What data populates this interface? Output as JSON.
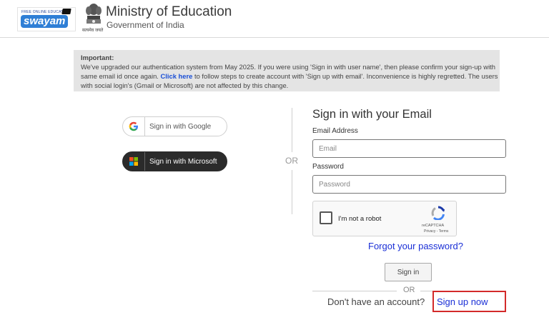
{
  "header": {
    "logo_small_text": "FREE ONLINE EDUCATION",
    "logo_word": "swayam",
    "emblem_motto": "सत्यमेव जयते",
    "ministry": "Ministry of Education",
    "government": "Government of India"
  },
  "notice": {
    "heading": "Important:",
    "text_before": "We've upgraded our authentication system from May 2025. If you were using 'Sign in with user name', then please confirm your sign-up with same email id once again. ",
    "link": "Click here",
    "text_after": " to follow steps to create account with 'Sign up with email'. Inconvenience is highly regretted. The users with social login's (Gmail or Microsoft) are not affected by this change."
  },
  "social": {
    "google_label": "Sign in with Google",
    "microsoft_label": "Sign in with Microsoft",
    "or": "OR"
  },
  "form": {
    "title": "Sign in with your Email",
    "email_label": "Email Address",
    "email_placeholder": "Email",
    "password_label": "Password",
    "password_placeholder": "Password",
    "forgot": "Forgot your password?",
    "signin": "Sign in",
    "or": "OR",
    "no_account": "Don't have an account?",
    "signup": "Sign up now"
  },
  "captcha": {
    "label": "I'm not a robot",
    "brand": "reCAPTCHA",
    "terms": "Privacy - Terms"
  },
  "colors": {
    "link": "#1a2fd6",
    "highlight": "#d32a2a",
    "notice_bg": "#e4e4e4"
  }
}
